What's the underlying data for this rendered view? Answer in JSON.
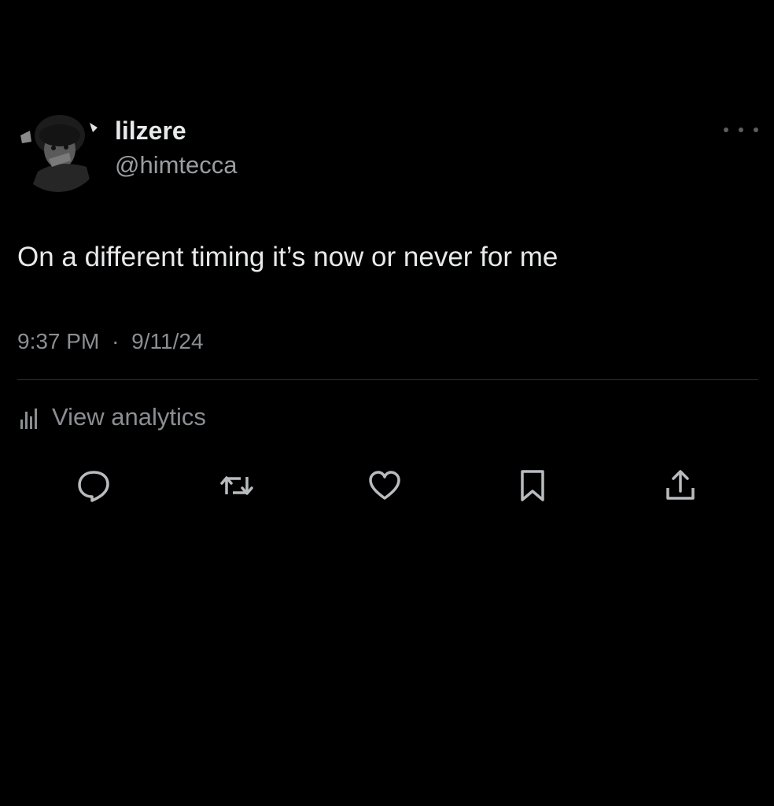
{
  "tweet": {
    "display_name": "lilzere",
    "handle": "@himtecca",
    "text": "On a different timing it’s now or never for me",
    "time": "9:37 PM",
    "separator": "·",
    "date": "9/11/24",
    "more_icon": "more-horizontal-icon"
  },
  "analytics": {
    "label": "View analytics",
    "icon": "analytics-bars-icon"
  },
  "actions": [
    {
      "name": "reply",
      "icon": "reply-bubble-icon"
    },
    {
      "name": "repost",
      "icon": "repost-arrows-icon"
    },
    {
      "name": "like",
      "icon": "heart-icon"
    },
    {
      "name": "bookmark",
      "icon": "bookmark-icon"
    },
    {
      "name": "share",
      "icon": "share-upload-icon"
    }
  ],
  "colors": {
    "background": "#000000",
    "primary_text": "#e7e9ea",
    "secondary_text": "#8b8e92",
    "icon": "#b9bcbf",
    "divider": "#2f3336"
  }
}
